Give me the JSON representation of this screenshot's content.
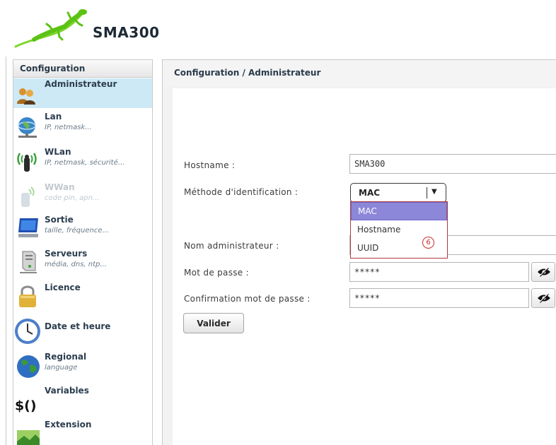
{
  "app": {
    "title": "SMA300"
  },
  "sidebar": {
    "title": "Configuration",
    "items": [
      {
        "label": "Administrateur",
        "sub": ""
      },
      {
        "label": "Lan",
        "sub": "IP, netmask..."
      },
      {
        "label": "WLan",
        "sub": "IP, netmask, sécurité..."
      },
      {
        "label": "WWan",
        "sub": "code pin, apn..."
      },
      {
        "label": "Sortie",
        "sub": "taille, fréquence..."
      },
      {
        "label": "Serveurs",
        "sub": "média, dns, ntp..."
      },
      {
        "label": "Licence",
        "sub": ""
      },
      {
        "label": "Date et heure",
        "sub": ""
      },
      {
        "label": "Regional",
        "sub": "language"
      },
      {
        "label": "Variables",
        "sub": ""
      },
      {
        "label": "Extension",
        "sub": ""
      }
    ]
  },
  "main": {
    "title": "Configuration / Administrateur",
    "form": {
      "hostname_label": "Hostname :",
      "hostname_value": "SMA300",
      "method_label": "Méthode d'identification :",
      "method_value": "MAC",
      "method_options": [
        "MAC",
        "Hostname",
        "UUID"
      ],
      "admin_label": "Nom administrateur :",
      "password_label": "Mot de passe :",
      "password_value": "*****",
      "confirm_label": "Confirmation mot de passe :",
      "confirm_value": "*****",
      "submit_label": "Valider"
    },
    "annotation_number": "6"
  },
  "colors": {
    "active_item_bg": "#cde9f6",
    "dropdown_selected_bg": "#8c87d9",
    "annotation_red": "#cc2a2a",
    "logo_green": "#6fd21e"
  },
  "icons": {
    "logo": "gecko-logo",
    "administrateur": "users-icon",
    "lan": "globe-network-icon",
    "wlan": "wireless-antenna-icon",
    "wwan": "cellular-icon",
    "sortie": "monitor-icon",
    "serveurs": "server-icon",
    "licence": "padlock-icon",
    "date": "clock-icon",
    "regional": "earth-icon",
    "variables": "dollar-braces-icon",
    "extension": "landscape-icon",
    "eye": "eye-toggle-icon"
  }
}
